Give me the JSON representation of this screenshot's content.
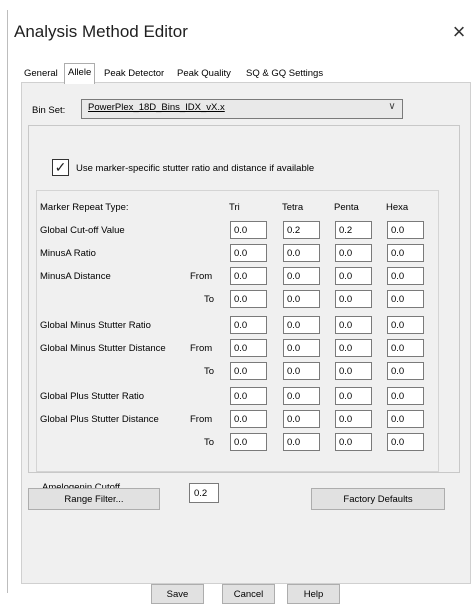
{
  "window": {
    "title": "Analysis Method Editor",
    "close_glyph": "×"
  },
  "tabs": [
    {
      "label": "General",
      "active": false
    },
    {
      "label": "Allele",
      "active": true
    },
    {
      "label": "Peak Detector",
      "active": false
    },
    {
      "label": "Peak Quality",
      "active": false
    },
    {
      "label": "SQ & GQ Settings",
      "active": false
    }
  ],
  "binset": {
    "label": "Bin Set:",
    "value": "PowerPlex_18D_Bins_IDX_vX.x",
    "arrow": "∨"
  },
  "stutter_checkbox": {
    "checked": true,
    "check_glyph": "✓",
    "label": "Use marker-specific stutter ratio and distance if available"
  },
  "grid": {
    "header_label": "Marker Repeat Type:",
    "columns": [
      "Tri",
      "Tetra",
      "Penta",
      "Hexa"
    ],
    "rows": [
      {
        "label": "Global Cut-off Value",
        "sub": "",
        "values": [
          "0.0",
          "0.2",
          "0.2",
          "0.0"
        ]
      },
      {
        "label": "MinusA Ratio",
        "sub": "",
        "values": [
          "0.0",
          "0.0",
          "0.0",
          "0.0"
        ]
      },
      {
        "label": "MinusA Distance",
        "sub": "From",
        "values": [
          "0.0",
          "0.0",
          "0.0",
          "0.0"
        ]
      },
      {
        "label": "",
        "sub": "To",
        "values": [
          "0.0",
          "0.0",
          "0.0",
          "0.0"
        ]
      },
      {
        "label": "Global Minus Stutter Ratio",
        "sub": "",
        "values": [
          "0.0",
          "0.0",
          "0.0",
          "0.0"
        ]
      },
      {
        "label": "Global Minus Stutter Distance",
        "sub": "From",
        "values": [
          "0.0",
          "0.0",
          "0.0",
          "0.0"
        ]
      },
      {
        "label": "",
        "sub": "To",
        "values": [
          "0.0",
          "0.0",
          "0.0",
          "0.0"
        ]
      },
      {
        "label": "Global Plus Stutter Ratio",
        "sub": "",
        "values": [
          "0.0",
          "0.0",
          "0.0",
          "0.0"
        ]
      },
      {
        "label": "Global Plus Stutter Distance",
        "sub": "From",
        "values": [
          "0.0",
          "0.0",
          "0.0",
          "0.0"
        ]
      },
      {
        "label": "",
        "sub": "To",
        "values": [
          "0.0",
          "0.0",
          "0.0",
          "0.0"
        ]
      }
    ]
  },
  "amelogenin": {
    "label": "Amelogenin Cutoff",
    "value": "0.2"
  },
  "buttons": {
    "range_filter": "Range Filter...",
    "factory_defaults": "Factory Defaults",
    "save": "Save",
    "cancel": "Cancel",
    "help": "Help"
  }
}
